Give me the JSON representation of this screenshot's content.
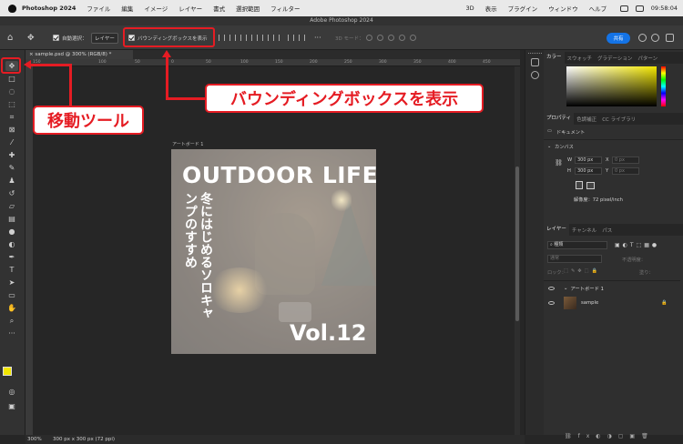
{
  "menubar": {
    "app_name": "Photoshop 2024",
    "items": [
      "ファイル",
      "編集",
      "イメージ",
      "レイヤー",
      "書式",
      "選択範囲",
      "フィルター"
    ],
    "right_items": [
      "3D",
      "表示",
      "プラグイン",
      "ウィンドウ",
      "ヘルプ"
    ],
    "clock": "09:58:04"
  },
  "window": {
    "title": "Adobe Photoshop 2024"
  },
  "options_bar": {
    "auto_select_label": "自動選択：",
    "auto_select_value": "レイヤー",
    "bounding_box_label": "バウンディングボックスを表示",
    "mode_3d_label": "3D モード：",
    "share_label": "共有"
  },
  "document": {
    "tab_label": "sample.psd @ 300% (RGB/8) *",
    "ruler_ticks": [
      "150",
      "100",
      "50",
      "0",
      "50",
      "100",
      "150",
      "200",
      "250",
      "300",
      "350",
      "400",
      "450"
    ],
    "zoom": "300%",
    "info": "300 px x 300 px (72 ppi)"
  },
  "artboard": {
    "label": "アートボード 1",
    "title": "OUTDOOR LIFE",
    "vertical_text": "冬にはじめるソロキャンプのすすめ",
    "issue": "Vol.12"
  },
  "color_panel": {
    "tabs": [
      "カラー",
      "スウォッチ",
      "グラデーション",
      "パターン"
    ],
    "fg_color": "#f2e600",
    "bg_color": "#000000"
  },
  "properties_panel": {
    "tabs": [
      "プロパティ",
      "色調補正",
      "CC ライブラリ"
    ],
    "doc_label": "ドキュメント",
    "canvas_label": "カンバス",
    "w_label": "W",
    "w_value": "300 px",
    "h_label": "H",
    "h_value": "300 px",
    "x_label": "X",
    "x_placeholder": "0 px",
    "y_label": "Y",
    "y_placeholder": "0 px",
    "resolution": "解像度：72 pixel/inch"
  },
  "layers_panel": {
    "tabs": [
      "レイヤー",
      "チャンネル",
      "パス"
    ],
    "filter_label": "種類",
    "blend_mode": "通常",
    "opacity_label": "不透明度：",
    "lock_label": "ロック：",
    "fill_label": "塗り：",
    "layers": [
      {
        "name": "アートボード 1",
        "type": "group"
      },
      {
        "name": "sample",
        "type": "image"
      }
    ]
  },
  "annotations": {
    "move_tool": "移動ツール",
    "bounding_box": "バウンディングボックスを表示",
    "accent_color": "#e51c23"
  }
}
